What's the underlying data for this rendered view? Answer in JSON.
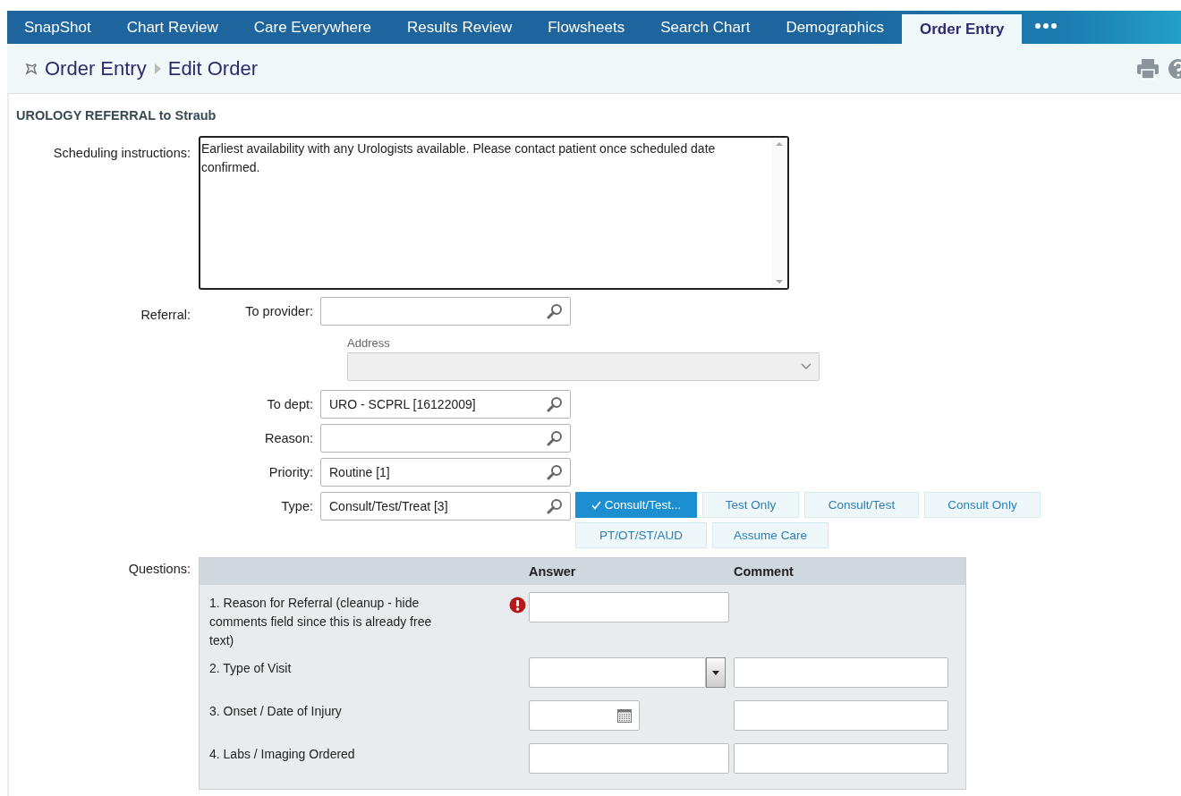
{
  "tabs": [
    {
      "label": "SnapShot",
      "selected": false
    },
    {
      "label": "Chart Review",
      "selected": false
    },
    {
      "label": "Care Everywhere",
      "selected": false
    },
    {
      "label": "Results Review",
      "selected": false
    },
    {
      "label": "Flowsheets",
      "selected": false
    },
    {
      "label": "Search Chart",
      "selected": false
    },
    {
      "label": "Demographics",
      "selected": false
    },
    {
      "label": "Order Entry",
      "selected": true
    }
  ],
  "breadcrumb": [
    "Order Entry",
    "Edit Order"
  ],
  "order_title": "UROLOGY REFERRAL to Straub",
  "scheduling": {
    "label": "Scheduling instructions:",
    "value": "Earliest availability with any Urologists available. Please contact patient once scheduled date confirmed."
  },
  "referral": {
    "label": "Referral:",
    "to_provider": {
      "label": "To provider:"
    },
    "address": {
      "label": "Address",
      "disabled": true
    },
    "fields": [
      {
        "label": "To dept:",
        "value": "URO - SCPRL [16122009]"
      },
      {
        "label": "Reason:"
      },
      {
        "label": "Priority:",
        "value": "Routine [1]"
      },
      {
        "label": "Type:",
        "value": "Consult/Test/Treat [3]"
      }
    ],
    "type_options": [
      {
        "label": "Consult/Test...",
        "selected": true
      },
      {
        "label": "Test Only",
        "selected": false
      },
      {
        "label": "Consult/Test",
        "selected": false
      },
      {
        "label": "Consult Only",
        "selected": false
      },
      {
        "label": "PT/OT/ST/AUD",
        "selected": false
      },
      {
        "label": "Assume Care",
        "selected": false
      }
    ]
  },
  "questions": {
    "label": "Questions:",
    "columns": [
      "Answer",
      "Comment"
    ],
    "rows": [
      {
        "text": "1. Reason for Referral (cleanup - hide comments field since this is already free text)",
        "kind": "text",
        "required": true,
        "comment": false
      },
      {
        "text": "2. Type of Visit",
        "kind": "dropdown",
        "required": false,
        "comment": true
      },
      {
        "text": "3. Onset / Date of Injury",
        "kind": "date",
        "required": false,
        "comment": true
      },
      {
        "text": "4. Labs / Imaging Ordered",
        "kind": "text",
        "required": false,
        "comment": true
      }
    ]
  }
}
